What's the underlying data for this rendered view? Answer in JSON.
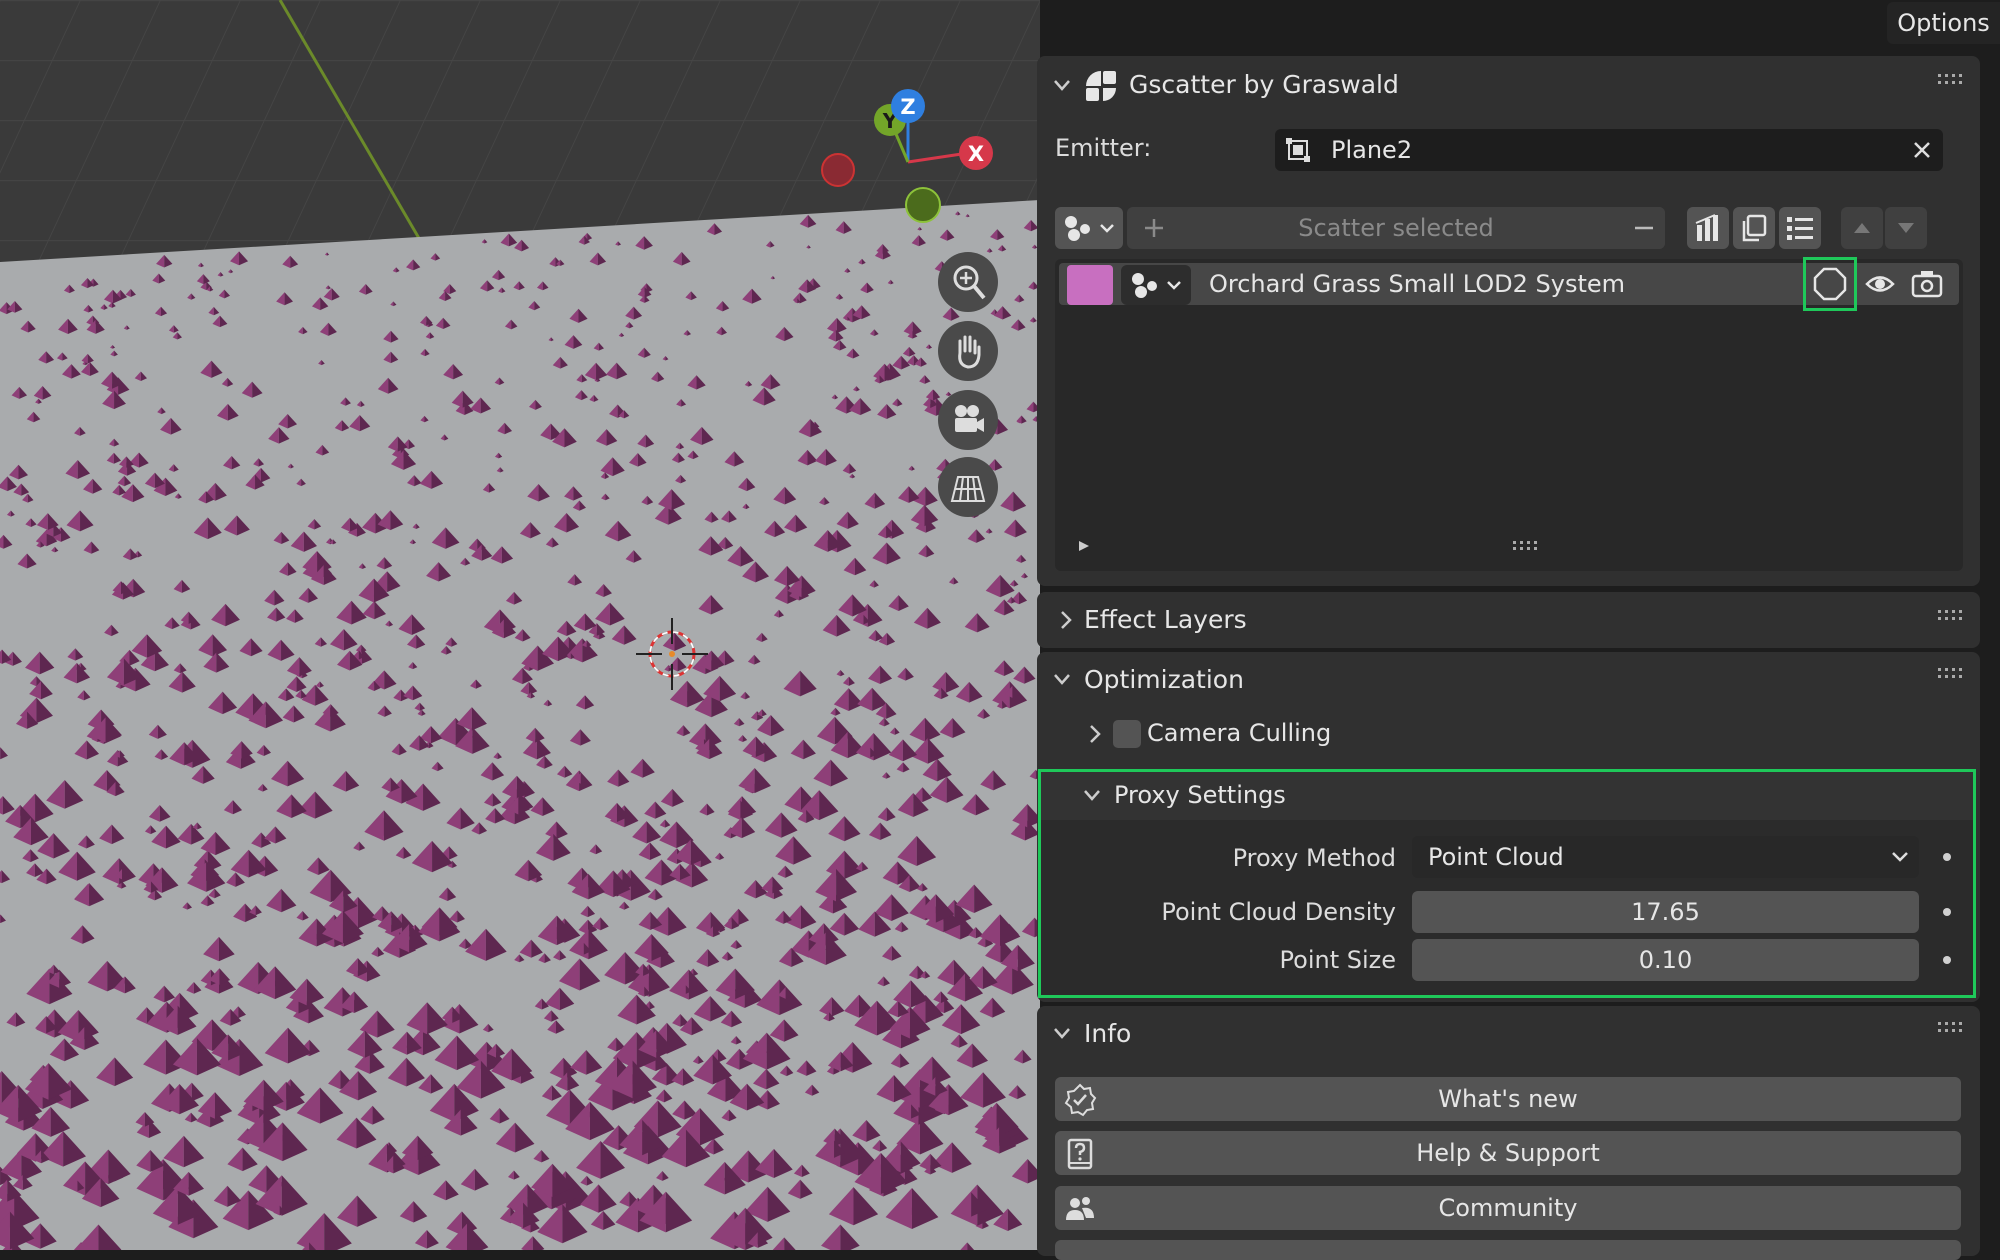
{
  "header": {
    "options_label": "Options"
  },
  "gscatter": {
    "title": "Gscatter by Graswald",
    "emitter_label": "Emitter:",
    "emitter_value": "Plane2",
    "scatter_selected_label": "Scatter selected",
    "system_name": "Orchard Grass Small LOD2 System",
    "system_color": "#c86fc0"
  },
  "effect_layers": {
    "title": "Effect Layers"
  },
  "optimization": {
    "title": "Optimization",
    "camera_culling_label": "Camera Culling",
    "proxy_settings_title": "Proxy Settings",
    "proxy_method_label": "Proxy Method",
    "proxy_method_value": "Point Cloud",
    "point_cloud_density_label": "Point Cloud Density",
    "point_cloud_density_value": "17.65",
    "point_size_label": "Point Size",
    "point_size_value": "0.10"
  },
  "info": {
    "title": "Info",
    "whats_new_label": "What's new",
    "help_support_label": "Help & Support",
    "community_label": "Community"
  },
  "gizmo": {
    "x_label": "X",
    "y_label": "Y",
    "z_label": "Z"
  },
  "colors": {
    "highlight": "#1fc85a",
    "accent_x": "#d6384a",
    "accent_y": "#73a529",
    "accent_z": "#2f7fe0"
  }
}
